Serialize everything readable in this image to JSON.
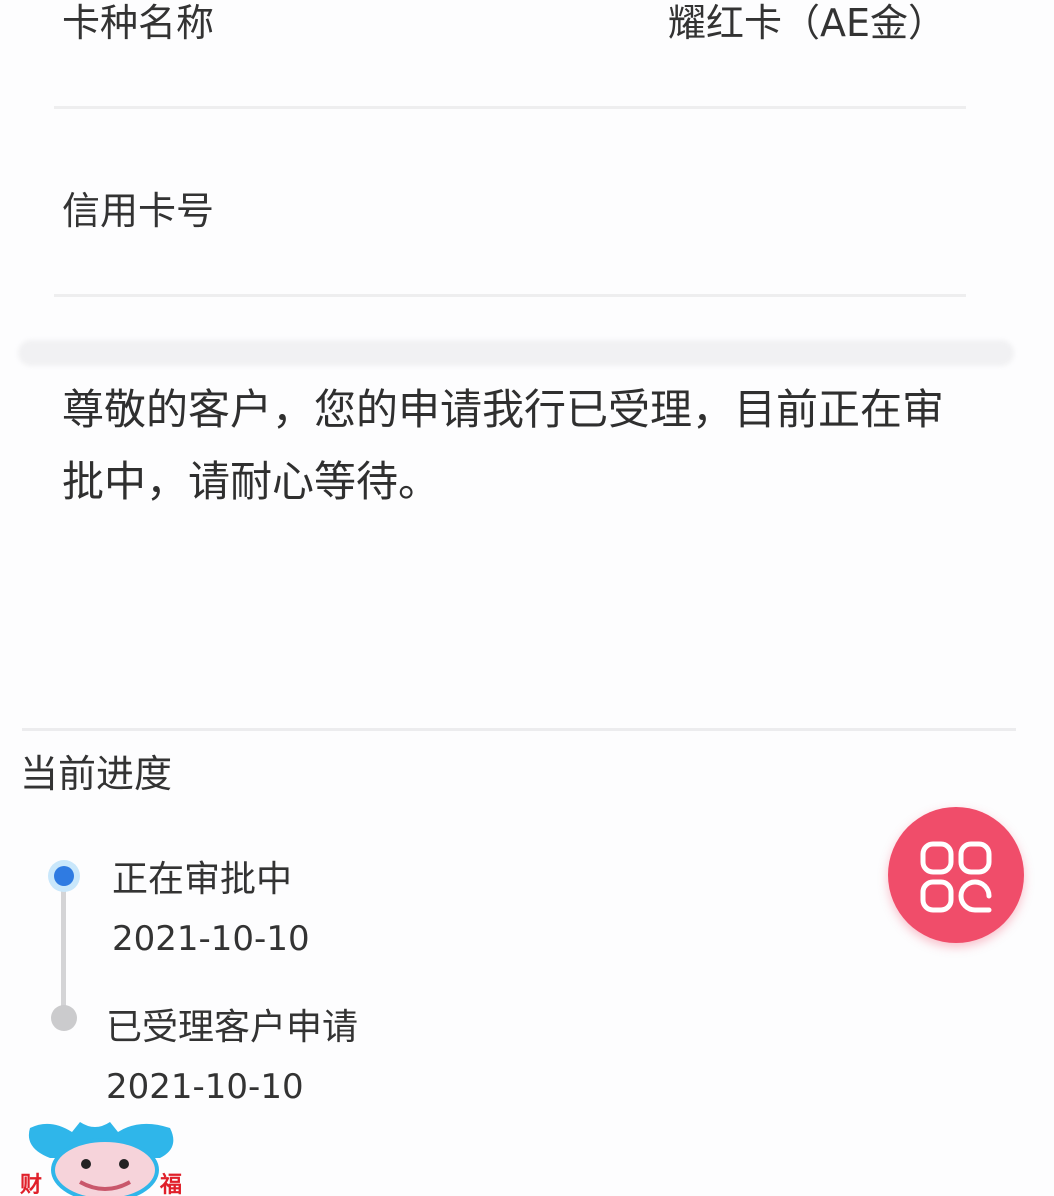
{
  "card": {
    "name_label": "卡种名称",
    "name_value": "耀红卡（AE金）",
    "number_label": "信用卡号",
    "number_value": ""
  },
  "notice": "尊敬的客户，您的申请我行已受理，目前正在审批中，请耐心等待。",
  "progress": {
    "title": "当前进度",
    "steps": [
      {
        "label": "正在审批中",
        "date": "2021-10-10",
        "active": true
      },
      {
        "label": "已受理客户申请",
        "date": "2021-10-10",
        "active": false
      }
    ]
  },
  "fab": {
    "icon": "grid-menu-icon",
    "color": "#f04d6a"
  },
  "mascot": {
    "left_char": "财",
    "right_char": "福"
  },
  "colors": {
    "active_dot": "#2f7be2",
    "inactive_dot": "#cbcbcd",
    "fab": "#f04d6a"
  }
}
